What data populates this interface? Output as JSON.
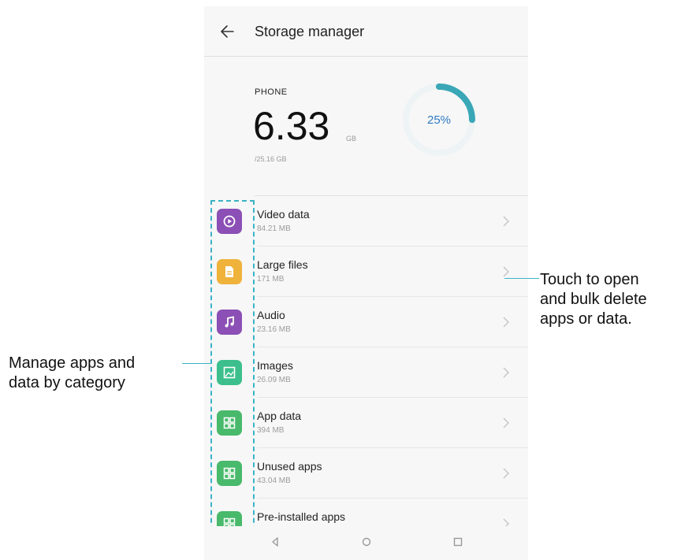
{
  "header": {
    "title": "Storage manager",
    "back_icon": "back-arrow-icon"
  },
  "summary": {
    "label": "PHONE",
    "used_value": "6.33",
    "used_unit": "GB",
    "total": "/25.16 GB",
    "percent_text": "25%",
    "percent_used": 0.25,
    "ring_color": "#3aa7b7"
  },
  "categories": [
    {
      "title": "Video data",
      "size": "84.21 MB",
      "icon": "video-icon",
      "color": "#8b4fb5"
    },
    {
      "title": "Large files",
      "size": "171 MB",
      "icon": "file-icon",
      "color": "#efb23b"
    },
    {
      "title": "Audio",
      "size": "23.16 MB",
      "icon": "music-note-icon",
      "color": "#8b4fb5"
    },
    {
      "title": "Images",
      "size": "26.09 MB",
      "icon": "image-icon",
      "color": "#3cbf8c"
    },
    {
      "title": "App data",
      "size": "394 MB",
      "icon": "app-grid-icon",
      "color": "#49b96b"
    },
    {
      "title": "Unused apps",
      "size": "43.04 MB",
      "icon": "app-grid-icon",
      "color": "#49b96b"
    },
    {
      "title": "Pre-installed apps",
      "size": "",
      "icon": "app-grid-icon",
      "color": "#49b96b"
    }
  ],
  "nav": {
    "back": "nav-back-icon",
    "home": "nav-home-icon",
    "recents": "nav-recents-icon"
  },
  "annotations": {
    "left_line1": "Manage apps and",
    "left_line2": "data by category",
    "right_line1": "Touch to open",
    "right_line2": "and bulk delete",
    "right_line3": "apps or data.",
    "accent": "#3bb3c6"
  }
}
